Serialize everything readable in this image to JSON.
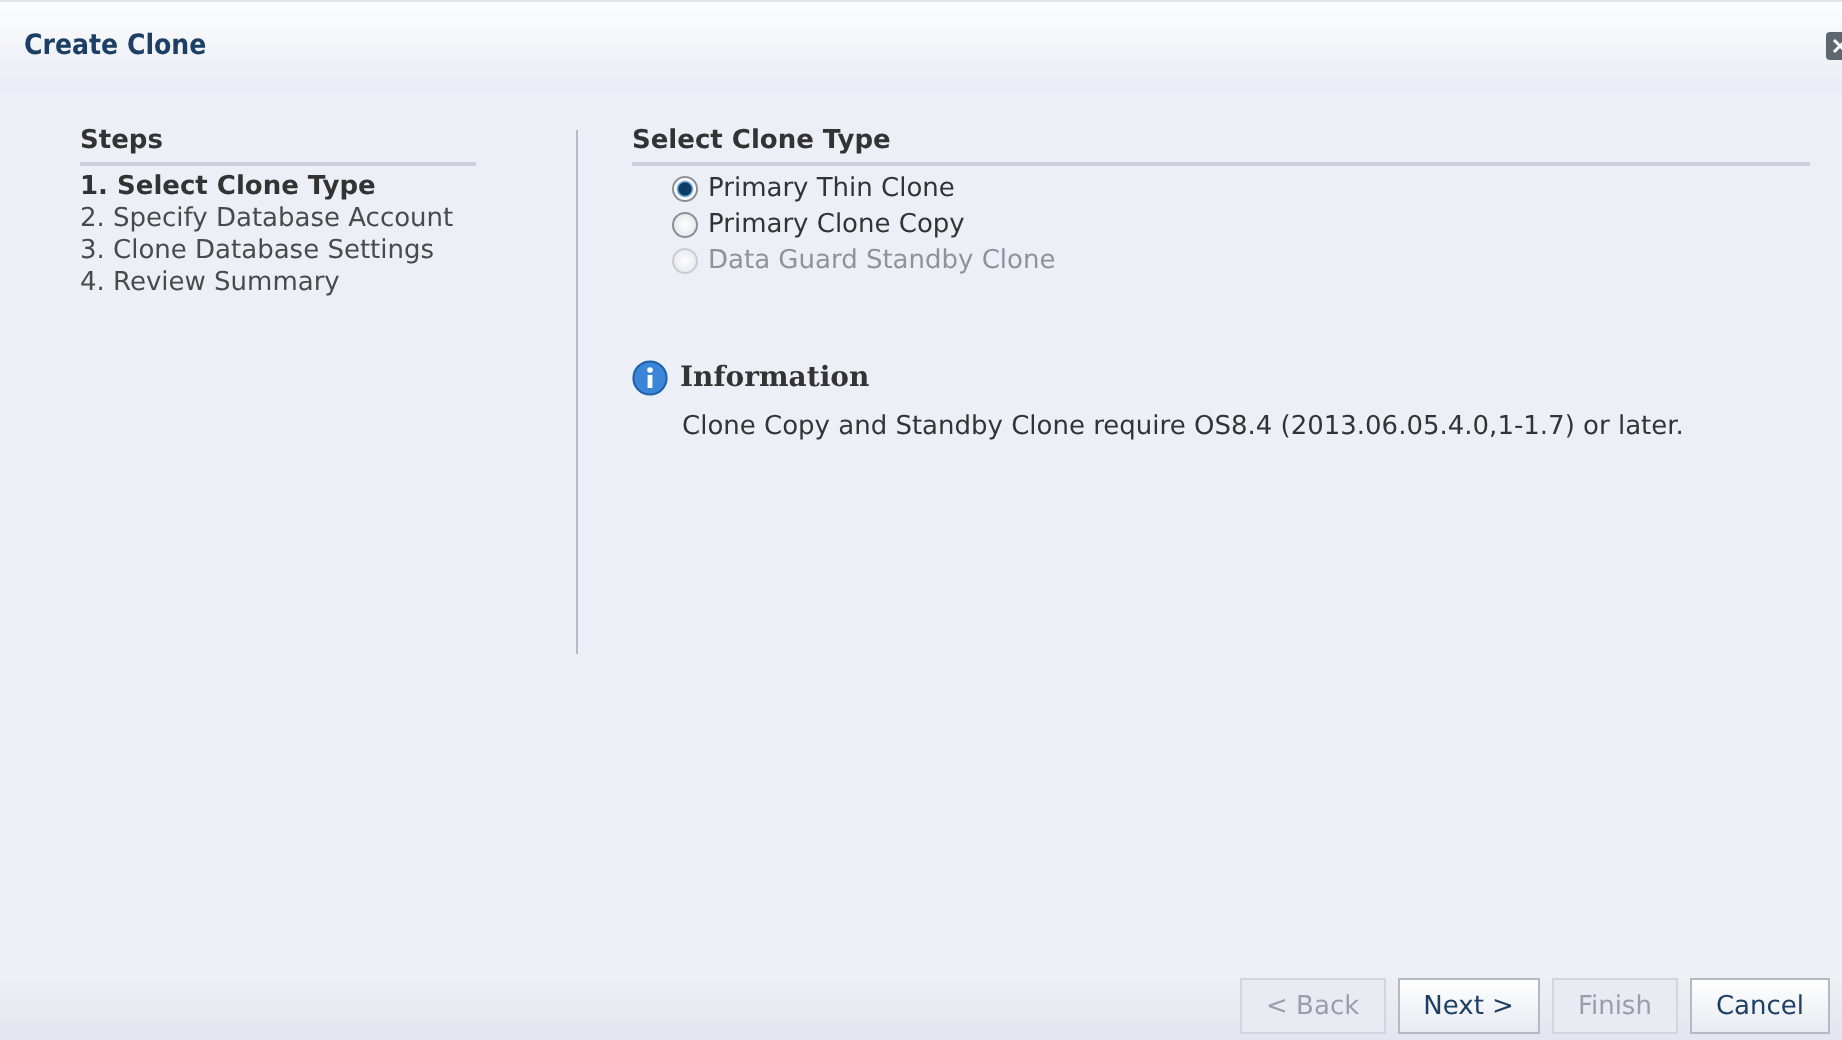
{
  "window": {
    "title": "Create Clone"
  },
  "steps": {
    "heading": "Steps",
    "items": [
      {
        "label": "1. Select Clone Type",
        "selected": true
      },
      {
        "label": "2. Specify Database Account",
        "selected": false
      },
      {
        "label": "3. Clone Database Settings",
        "selected": false
      },
      {
        "label": "4. Review Summary",
        "selected": false
      }
    ]
  },
  "section": {
    "heading": "Select Clone Type",
    "options": [
      {
        "label": "Primary Thin Clone",
        "selected": true,
        "disabled": false
      },
      {
        "label": "Primary Clone Copy",
        "selected": false,
        "disabled": false
      },
      {
        "label": "Data Guard Standby Clone",
        "selected": false,
        "disabled": true
      }
    ]
  },
  "info": {
    "title": "Information",
    "text": "Clone Copy and Standby Clone require OS8.4 (2013.06.05.4.0,1-1.7) or later."
  },
  "buttons": [
    {
      "label": "< Back",
      "disabled": true
    },
    {
      "label": "Next >",
      "disabled": false
    },
    {
      "label": "Finish",
      "disabled": true
    },
    {
      "label": "Cancel",
      "disabled": false
    }
  ]
}
